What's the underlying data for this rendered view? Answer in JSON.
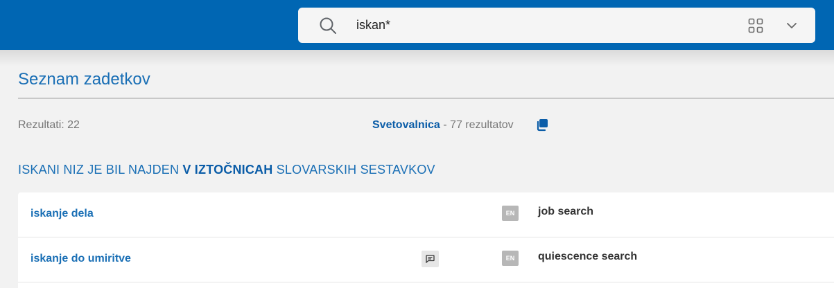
{
  "header": {
    "search_value": "iskan*",
    "accent_color": "#0066b3",
    "icons": [
      "search-icon",
      "grid-icon",
      "chevron-down-icon"
    ]
  },
  "main": {
    "title": "Seznam zadetkov",
    "results_count": "Rezultati: 22",
    "external": {
      "link_label": "Svetovalnica",
      "count_text": " - 77 rezultatov",
      "icon": "copy-icon"
    },
    "section_heading": {
      "prefix": "ISKANI NIZ JE BIL NAJDEN ",
      "bold": "V IZTOČNICAH",
      "suffix": " SLOVARSKIH SESTAVKOV"
    },
    "rows": [
      {
        "term": "iskanje dela",
        "lang": "EN",
        "translation": "job search",
        "has_note": false
      },
      {
        "term": "iskanje do umiritve",
        "lang": "EN",
        "translation": "quiescence search",
        "has_note": true
      }
    ]
  }
}
